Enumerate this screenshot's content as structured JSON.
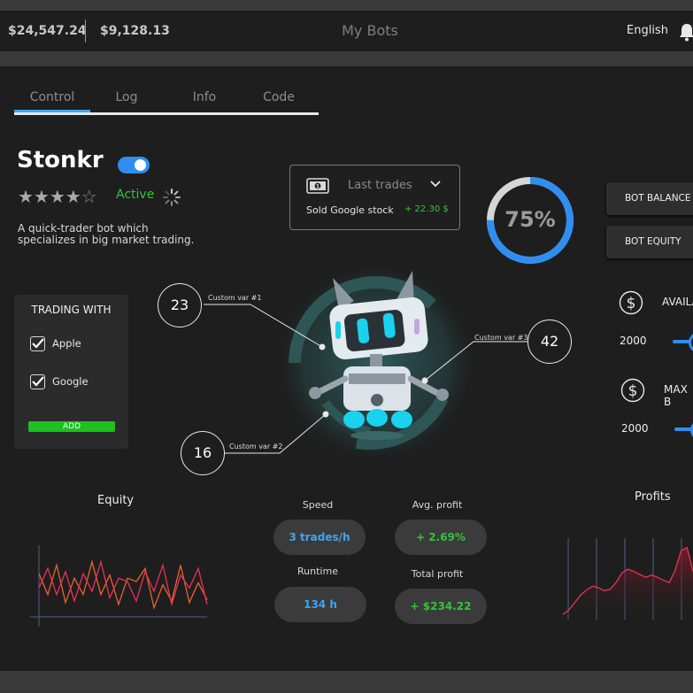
{
  "header": {
    "balance_primary": "$24,547.24",
    "balance_secondary": "$9,128.13",
    "title": "My Bots",
    "language": "English"
  },
  "tabs": [
    {
      "label": "Control",
      "active": true
    },
    {
      "label": "Log",
      "active": false
    },
    {
      "label": "Info",
      "active": false
    },
    {
      "label": "Code",
      "active": false
    }
  ],
  "bot": {
    "name": "Stonkr",
    "enabled": true,
    "rating": 4,
    "rating_max": 5,
    "status": "Active",
    "description": "A quick-trader bot which specializes in big market trading."
  },
  "trading_with": {
    "title": "TRADING WITH",
    "items": [
      {
        "label": "Apple",
        "checked": true
      },
      {
        "label": "Google",
        "checked": true
      }
    ],
    "add_label": "ADD"
  },
  "last_trades": {
    "title": "Last trades",
    "entry_text": "Sold Google stock",
    "entry_amount": "+ 22.30 $"
  },
  "gauge": {
    "value": 0.75,
    "label": "75%"
  },
  "side_buttons": {
    "balance": "BOT BALANCE",
    "equity": "BOT EQUITY"
  },
  "right_controls": [
    {
      "label": "AVAILA",
      "value": "2000"
    },
    {
      "label": "MAX B",
      "value": "2000"
    }
  ],
  "custom_vars": [
    {
      "value": "23",
      "label": "Custom var #1"
    },
    {
      "value": "16",
      "label": "Custom var #2"
    },
    {
      "value": "42",
      "label": "Custom var #3"
    }
  ],
  "metrics": {
    "speed": {
      "label": "Speed",
      "value": "3 trades/h"
    },
    "avg_profit": {
      "label": "Avg. profit",
      "value": "+ 2.69%"
    },
    "runtime": {
      "label": "Runtime",
      "value": "134 h"
    },
    "total_profit": {
      "label": "Total profit",
      "value": "+ $234.22"
    }
  },
  "equity": {
    "title": "Equity"
  },
  "profits": {
    "title": "Profits"
  },
  "colors": {
    "accent": "#3da6f5",
    "positive": "#31c43a",
    "chart_orange": "#e8642c",
    "chart_pink": "#e8325a"
  },
  "chart_data": [
    {
      "type": "line",
      "title": "Equity",
      "x": [
        0,
        1,
        2,
        3,
        4,
        5,
        6,
        7,
        8,
        9,
        10,
        11,
        12,
        13,
        14,
        15,
        16,
        17,
        18,
        19
      ],
      "series": [
        {
          "values": [
            62,
            30,
            75,
            18,
            55,
            30,
            80,
            30,
            60,
            15,
            55,
            50,
            70,
            10,
            45,
            20,
            75,
            18,
            48,
            22
          ]
        },
        {
          "values": [
            40,
            70,
            30,
            65,
            20,
            62,
            35,
            80,
            25,
            55,
            50,
            20,
            65,
            35,
            75,
            15,
            60,
            40,
            70,
            15
          ]
        }
      ],
      "ylim": [
        0,
        100
      ]
    },
    {
      "type": "area",
      "title": "Profits",
      "x": [
        0,
        1,
        2,
        3,
        4,
        5,
        6,
        7,
        8,
        9,
        10,
        11,
        12,
        13,
        14,
        15,
        16,
        17,
        18,
        19,
        20,
        21,
        22
      ],
      "values": [
        2,
        8,
        18,
        28,
        35,
        40,
        38,
        34,
        36,
        45,
        58,
        63,
        60,
        56,
        52,
        55,
        52,
        48,
        45,
        62,
        88,
        92,
        60
      ],
      "ylim": [
        0,
        100
      ]
    }
  ]
}
